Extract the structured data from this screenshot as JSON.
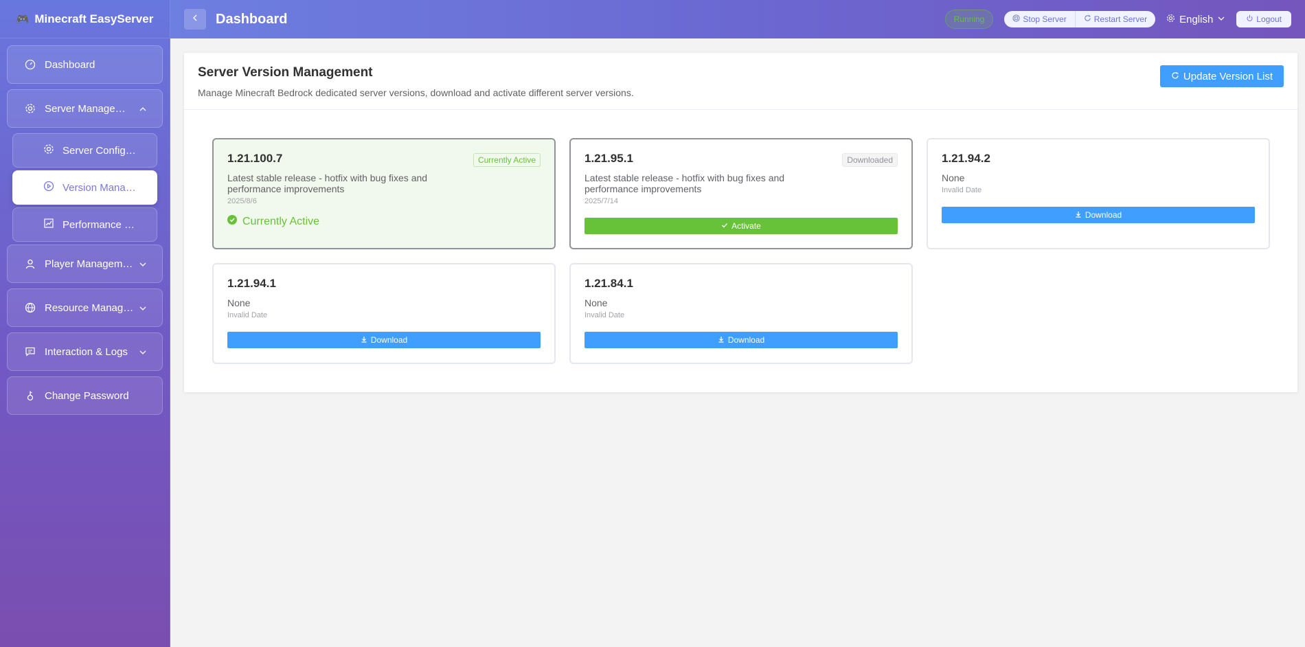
{
  "app": {
    "title": "Minecraft EasyServer"
  },
  "sidebar": {
    "items": [
      {
        "label": "Dashboard"
      },
      {
        "label": "Server Management"
      },
      {
        "label": "Player Management"
      },
      {
        "label": "Resource Management"
      },
      {
        "label": "Interaction & Logs"
      },
      {
        "label": "Change Password"
      }
    ],
    "sub_items": [
      {
        "label": "Server Configuration"
      },
      {
        "label": "Version Management"
      },
      {
        "label": "Performance Monitor"
      }
    ]
  },
  "header": {
    "title": "Dashboard",
    "status": "Running",
    "stop_label": "Stop Server",
    "restart_label": "Restart Server",
    "language": "English",
    "logout_label": "Logout"
  },
  "panel": {
    "title": "Server Version Management",
    "description": "Manage Minecraft Bedrock dedicated server versions, download and activate different server versions.",
    "update_label": "Update Version List"
  },
  "versions": [
    {
      "version": "1.21.100.7",
      "tag": "Currently Active",
      "description": "Latest stable release - hotfix with bug fixes and performance improvements",
      "date": "2025/8/6",
      "status_text": "Currently Active"
    },
    {
      "version": "1.21.95.1",
      "tag": "Downloaded",
      "description": "Latest stable release - hotfix with bug fixes and performance improvements",
      "date": "2025/7/14",
      "action": "Activate"
    },
    {
      "version": "1.21.94.2",
      "description": "None",
      "date": "Invalid Date",
      "action": "Download"
    },
    {
      "version": "1.21.94.1",
      "description": "None",
      "date": "Invalid Date",
      "action": "Download"
    },
    {
      "version": "1.21.84.1",
      "description": "None",
      "date": "Invalid Date",
      "action": "Download"
    }
  ],
  "colors": {
    "accent": "#409eff",
    "success": "#67c23a",
    "sidebar_top": "#6877de",
    "sidebar_bottom": "#7a4eb0"
  }
}
